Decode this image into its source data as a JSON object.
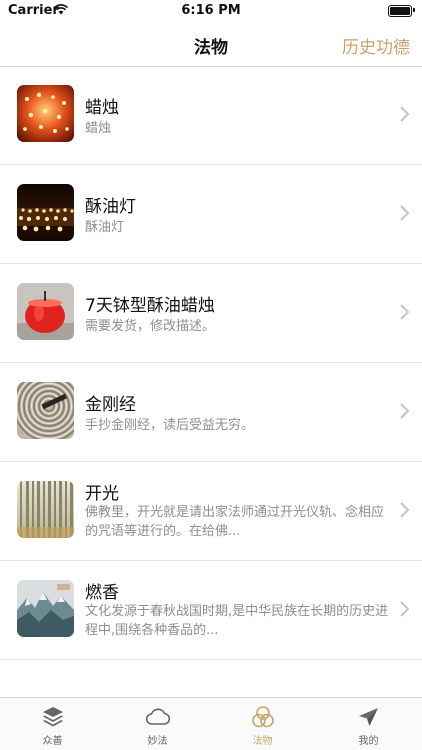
{
  "status_bar": {
    "carrier": "Carrier",
    "time": "6:16 PM"
  },
  "nav": {
    "title": "法物",
    "right_label": "历史功德"
  },
  "items": [
    {
      "title": "蜡烛",
      "subtitle": "蜡烛",
      "image": "candles-photo"
    },
    {
      "title": "酥油灯",
      "subtitle": "酥油灯",
      "image": "butter-lamps-photo"
    },
    {
      "title": "7天钵型酥油蜡烛",
      "subtitle": "需要发货，修改描述。",
      "image": "bowl-candle-photo"
    },
    {
      "title": "金刚经",
      "subtitle": "手抄金刚经，读后受益无穷。",
      "image": "diamond-sutra-scroll-photo"
    },
    {
      "title": "开光",
      "subtitle": "佛教里，开光就是请出家法师通过开光仪轨、念相应的咒语等进行的。在给佛...",
      "image": "bamboo-forest-photo"
    },
    {
      "title": "燃香",
      "subtitle": "文化发源于春秋战国时期,是中华民族在长期的历史进程中,围绕各种香品的...",
      "image": "mountain-painting-photo"
    }
  ],
  "tabs": [
    {
      "label": "众善",
      "icon": "layers-icon",
      "active": false
    },
    {
      "label": "妙法",
      "icon": "cloud-icon",
      "active": false
    },
    {
      "label": "法物",
      "icon": "three-circles-icon",
      "active": true
    },
    {
      "label": "我的",
      "icon": "paper-plane-icon",
      "active": false
    }
  ],
  "colors": {
    "accent": "#c8a46a",
    "inactive": "#666666",
    "subtitle": "#8e8e93"
  }
}
